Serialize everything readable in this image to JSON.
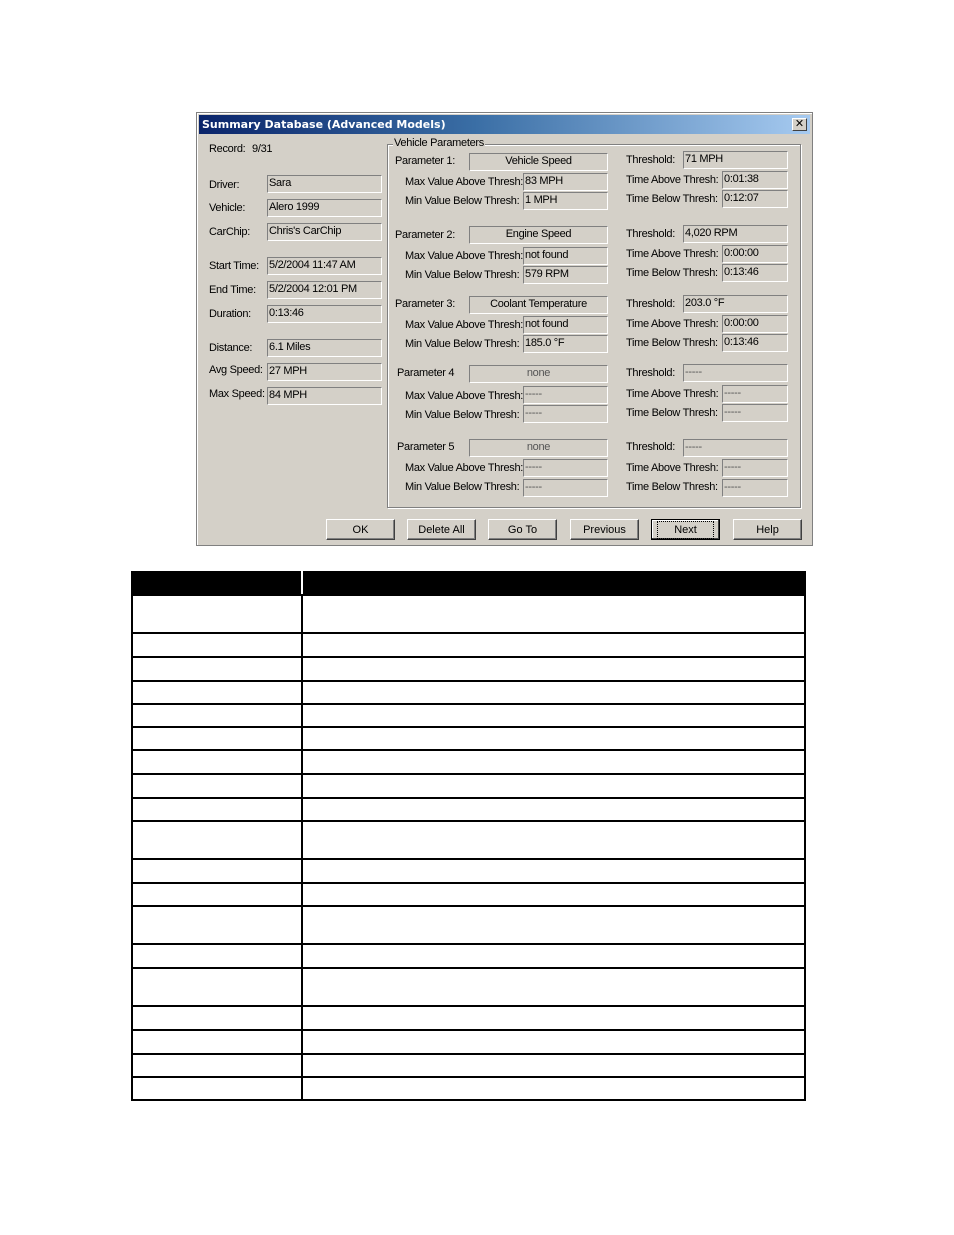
{
  "dialog": {
    "title": "Summary Database  (Advanced Models)",
    "close_glyph": "✕",
    "record_label": "Record:",
    "record_value": "9/31",
    "summary": {
      "driver": {
        "label": "Driver:",
        "value": "Sara"
      },
      "vehicle": {
        "label": "Vehicle:",
        "value": "Alero 1999"
      },
      "carchip": {
        "label": "CarChip:",
        "value": "Chris's CarChip"
      },
      "start_time": {
        "label": "Start Time:",
        "value": "5/2/2004  11:47 AM"
      },
      "end_time": {
        "label": "End Time:",
        "value": "5/2/2004  12:01 PM"
      },
      "duration": {
        "label": "Duration:",
        "value": "0:13:46"
      },
      "distance": {
        "label": "Distance:",
        "value": "6.1 Miles"
      },
      "avg_speed": {
        "label": "Avg Speed:",
        "value": "27 MPH"
      },
      "max_speed": {
        "label": "Max Speed:",
        "value": "84 MPH"
      }
    },
    "vehicle_parameters": {
      "group_title": "Vehicle Parameters",
      "max_label": "Max Value Above Thresh:",
      "min_label": "Min Value Below Thresh:",
      "threshold_label": "Threshold:",
      "time_above_label": "Time Above Thresh:",
      "time_below_label": "Time Below Thresh:",
      "params": [
        {
          "label": "Parameter 1:",
          "name": "Vehicle Speed",
          "max_value": "83 MPH",
          "min_value": "1 MPH",
          "threshold": "71 MPH",
          "time_above": "0:01:38",
          "time_below": "0:12:07"
        },
        {
          "label": "Parameter 2:",
          "name": "Engine Speed",
          "max_value": "not found",
          "min_value": "579 RPM",
          "threshold": "4,020 RPM",
          "time_above": "0:00:00",
          "time_below": "0:13:46"
        },
        {
          "label": "Parameter 3:",
          "name": "Coolant Temperature",
          "max_value": "not found",
          "min_value": "185.0 °F",
          "threshold": "203.0 °F",
          "time_above": "0:00:00",
          "time_below": "0:13:46"
        },
        {
          "label": "Parameter 4",
          "name": "none",
          "max_value": "-----",
          "min_value": "-----",
          "threshold": "-----",
          "time_above": "-----",
          "time_below": "-----"
        },
        {
          "label": "Parameter 5",
          "name": "none",
          "max_value": "-----",
          "min_value": "-----",
          "threshold": "-----",
          "time_above": "-----",
          "time_below": "-----"
        }
      ]
    },
    "buttons": {
      "ok": "OK",
      "delete_all": "Delete All",
      "go_to": "Go To",
      "previous": "Previous",
      "next": "Next",
      "help": "Help"
    }
  },
  "doc_table": {
    "headers": [
      "",
      ""
    ],
    "row_count": 19
  }
}
